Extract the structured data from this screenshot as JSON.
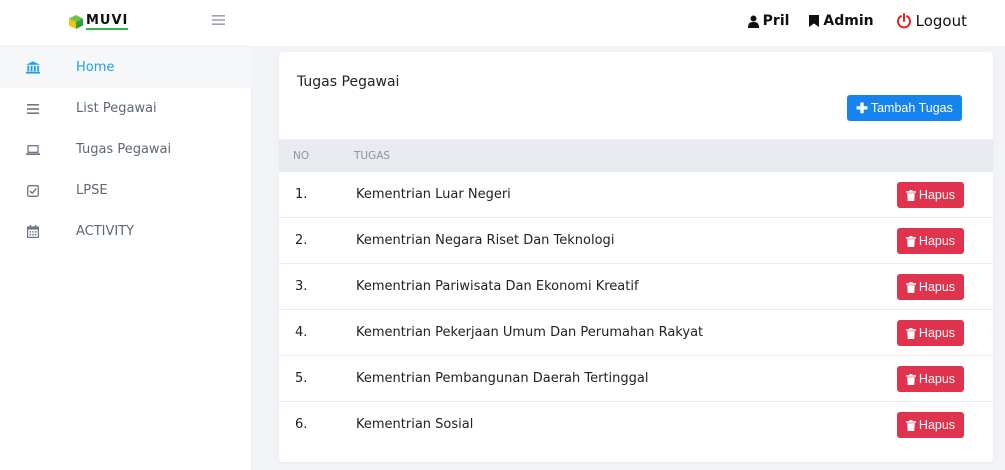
{
  "brand": {
    "name": "MUVI"
  },
  "user": {
    "name": "Pril",
    "role": "Admin",
    "logout_label": "Logout"
  },
  "sidebar": {
    "items": [
      {
        "label": "Home",
        "icon": "bank-icon",
        "active": true
      },
      {
        "label": "List Pegawai",
        "icon": "list-icon",
        "active": false
      },
      {
        "label": "Tugas Pegawai",
        "icon": "laptop-icon",
        "active": false
      },
      {
        "label": "LPSE",
        "icon": "checkbox-icon",
        "active": false
      },
      {
        "label": "ACTIVITY",
        "icon": "calendar-icon",
        "active": false
      }
    ]
  },
  "main": {
    "title": "Tugas Pegawai",
    "add_button_label": "Tambah Tugas",
    "table": {
      "columns": [
        "NO",
        "TUGAS"
      ],
      "delete_label": "Hapus",
      "rows": [
        {
          "no": "1.",
          "tugas": "Kementrian Luar Negeri"
        },
        {
          "no": "2.",
          "tugas": "Kementrian Negara Riset Dan Teknologi"
        },
        {
          "no": "3.",
          "tugas": "Kementrian Pariwisata Dan Ekonomi Kreatif"
        },
        {
          "no": "4.",
          "tugas": "Kementrian Pekerjaan Umum Dan Perumahan Rakyat"
        },
        {
          "no": "5.",
          "tugas": "Kementrian Pembangunan Daerah Tertinggal"
        },
        {
          "no": "6.",
          "tugas": "Kementrian Sosial"
        }
      ]
    }
  },
  "colors": {
    "accent": "#1584ee",
    "danger": "#e0334d",
    "active_link": "#1ea0e6",
    "logout_icon": "#e52222"
  }
}
